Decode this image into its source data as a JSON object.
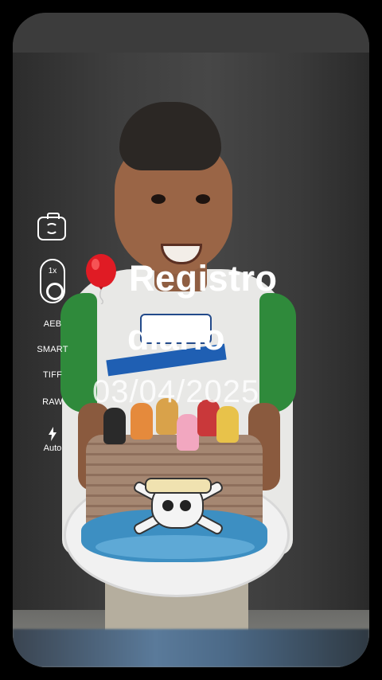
{
  "sidebar": {
    "zoom_label": "1x",
    "options": [
      "AEB",
      "SMART",
      "TIFF",
      "RAW"
    ],
    "flash_label": "Auto"
  },
  "overlay": {
    "title_line1": "Registro",
    "title_line2": "diário",
    "date": "03/04/2025"
  },
  "colors": {
    "balloon": "#e01b24",
    "frosting": "#3d8fc2",
    "shirt_sleeves": "#2f8a3b"
  },
  "icons": [
    "camera-switch-icon",
    "balloon-icon",
    "flash-icon"
  ]
}
